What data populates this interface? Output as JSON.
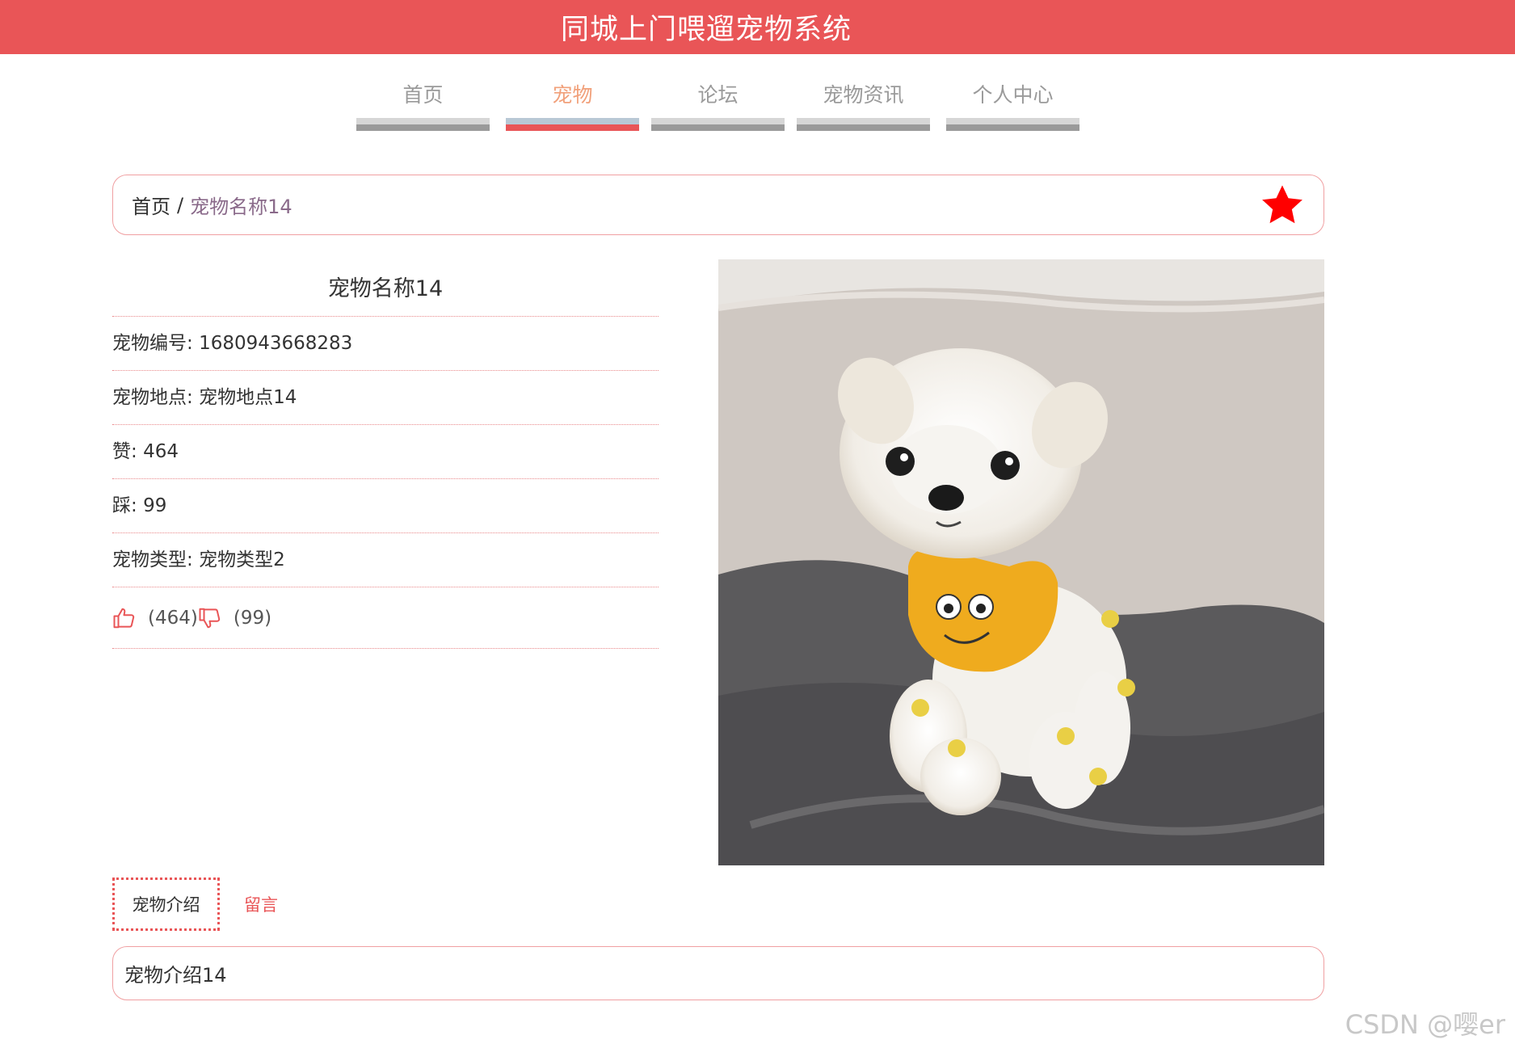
{
  "header": {
    "title": "同城上门喂遛宠物系统"
  },
  "nav": {
    "items": [
      {
        "label": "首页",
        "active": false
      },
      {
        "label": "宠物",
        "active": true
      },
      {
        "label": "论坛",
        "active": false
      },
      {
        "label": "宠物资讯",
        "active": false
      },
      {
        "label": "个人中心",
        "active": false
      }
    ]
  },
  "breadcrumb": {
    "home": "首页",
    "separator": "/",
    "current": "宠物名称14",
    "favorite_icon": "star-icon",
    "favorite_color": "#ff0000"
  },
  "pet": {
    "name": "宠物名称14",
    "rows": [
      {
        "label": "宠物编号",
        "value": "1680943668283"
      },
      {
        "label": "宠物地点",
        "value": "宠物地点14"
      },
      {
        "label": "赞",
        "value": "464"
      },
      {
        "label": "踩",
        "value": "99"
      },
      {
        "label": "宠物类型",
        "value": "宠物类型2"
      }
    ],
    "like_count": "(464)",
    "dislike_count": "(99)"
  },
  "tabs": {
    "intro": "宠物介绍",
    "comments": "留言"
  },
  "intro": {
    "text": "宠物介绍14"
  },
  "watermark": "CSDN @嘤er",
  "colors": {
    "accent": "#e95557",
    "nav_active_text": "#f1a07a",
    "nav_text": "#9a9a9a"
  }
}
